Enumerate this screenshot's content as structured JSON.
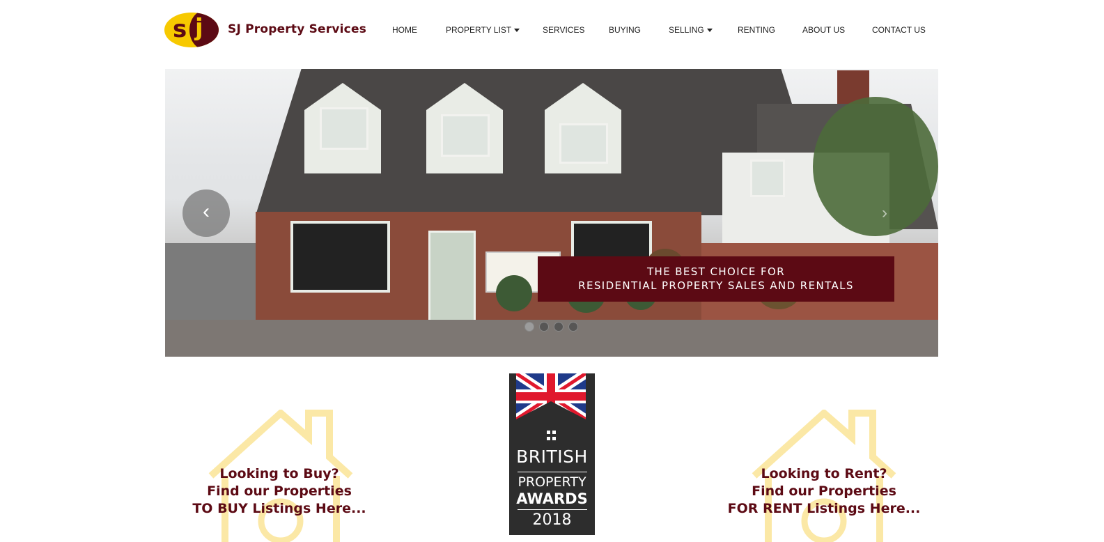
{
  "brand": {
    "name": "SJ Property Services",
    "logo_letters": [
      "s",
      "j"
    ]
  },
  "nav": [
    {
      "label": "HOME",
      "dropdown": false
    },
    {
      "label": "PROPERTY LIST",
      "dropdown": true
    },
    {
      "label": "SERVICES",
      "dropdown": false
    },
    {
      "label": "BUYING",
      "dropdown": false
    },
    {
      "label": "SELLING",
      "dropdown": true
    },
    {
      "label": "RENTING",
      "dropdown": false
    },
    {
      "label": "ABOUT US",
      "dropdown": false
    },
    {
      "label": "CONTACT US",
      "dropdown": false
    }
  ],
  "hero": {
    "caption_line1": "THE BEST CHOICE FOR",
    "caption_line2": "RESIDENTIAL PROPERTY SALES AND RENTALS",
    "prev_icon": "‹",
    "next_icon": "›",
    "slides": 4,
    "active_slide": 1
  },
  "award": {
    "line1": "BRITISH",
    "line2": "PROPERTY",
    "line3": "AWARDS",
    "year": "2018",
    "stars": "★★★★★"
  },
  "cta_buy": {
    "line1": "Looking to Buy?",
    "line2": "Find our Properties",
    "line3": "TO BUY Listings Here..."
  },
  "cta_rent": {
    "line1": "Looking to Rent?",
    "line2": "Find our Properties",
    "line3": "FOR RENT Listings Here..."
  },
  "colors": {
    "brand": "#5c0a14",
    "accent": "#f7c900",
    "outline": "#fbe8a6"
  }
}
